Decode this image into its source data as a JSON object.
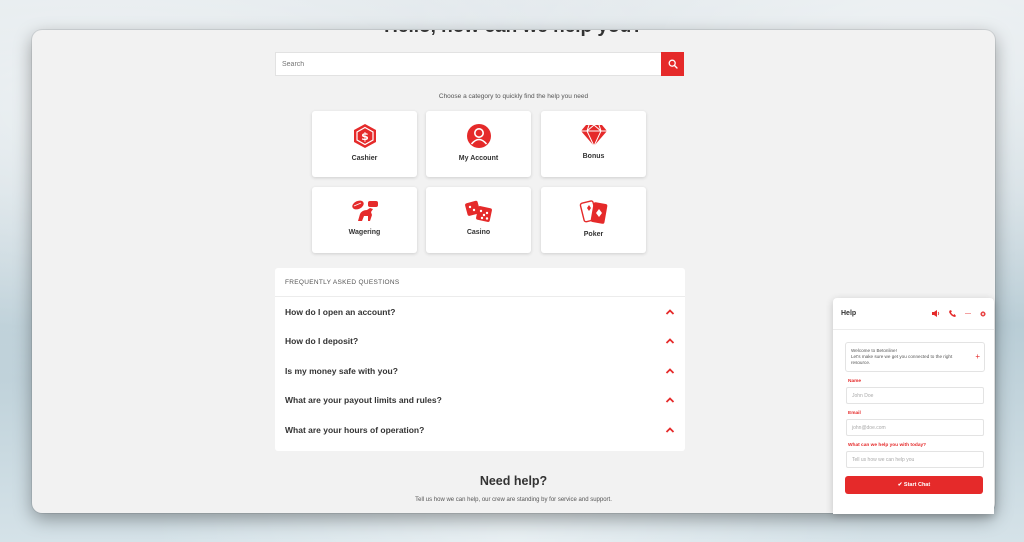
{
  "heading": "Hello, how can we help you?",
  "search": {
    "placeholder": "Search"
  },
  "subtitle": "Choose a category to quickly find the help you need",
  "categories": [
    {
      "label": "Cashier",
      "icon": "cashier-dollar-icon"
    },
    {
      "label": "My Account",
      "icon": "user-account-icon"
    },
    {
      "label": "Bonus",
      "icon": "diamond-icon"
    },
    {
      "label": "Wagering",
      "icon": "sports-horse-icon"
    },
    {
      "label": "Casino",
      "icon": "dice-icon"
    },
    {
      "label": "Poker",
      "icon": "playing-cards-icon"
    }
  ],
  "faq": {
    "title": "FREQUENTLY ASKED QUESTIONS",
    "items": [
      {
        "question": "How do I open an account?"
      },
      {
        "question": "How do I deposit?"
      },
      {
        "question": "Is my money safe with you?"
      },
      {
        "question": "What are your payout limits and rules?"
      },
      {
        "question": "What are your hours of operation?"
      }
    ]
  },
  "need_help": {
    "title": "Need help?",
    "subtitle": "Tell us how we can help, our crew are standing by for service and support."
  },
  "chat": {
    "title": "Help",
    "welcome_line1": "Welcome to Betonline!",
    "welcome_line2": "Let's make sure we get you connected to the right resource.",
    "name_label": "Name",
    "name_placeholder": "John Doe",
    "email_label": "Email",
    "email_placeholder": "john@doe.com",
    "question_label": "What can we help you with today?",
    "question_placeholder": "Tell us how we can help you",
    "start_button": "✔ Start Chat"
  },
  "colors": {
    "accent": "#e52a2a",
    "panel_bg": "#f2f2f2"
  }
}
